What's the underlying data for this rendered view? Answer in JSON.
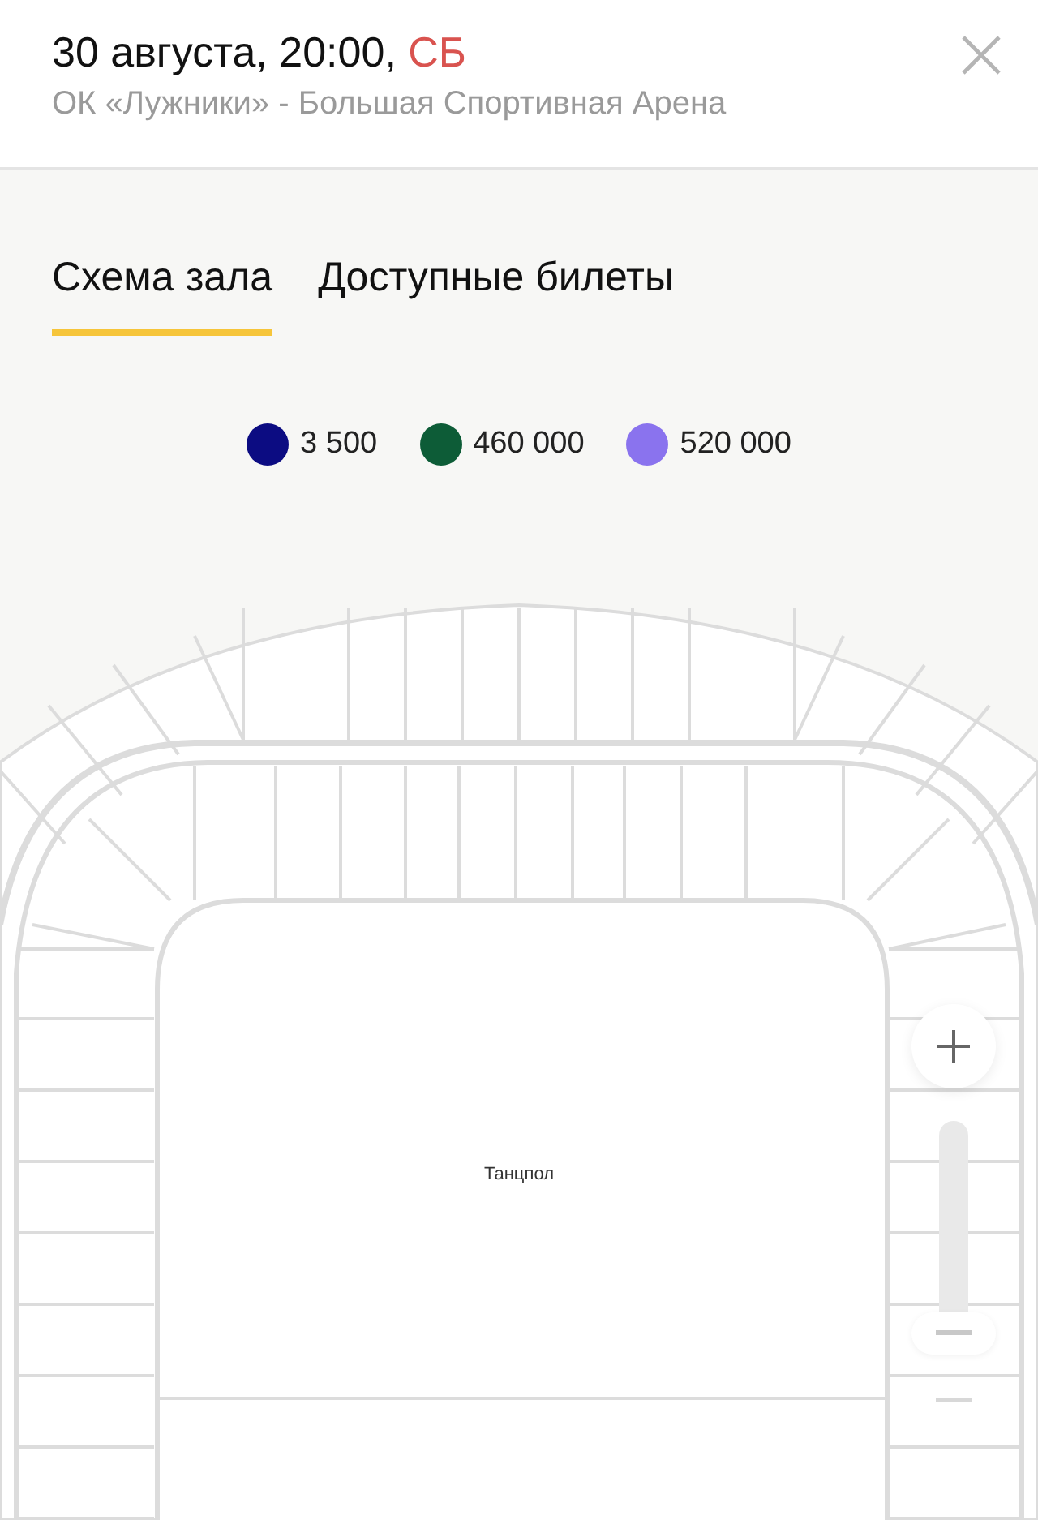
{
  "header": {
    "date": "30 августа, 20:00,",
    "weekday": "СБ",
    "venue": "ОК «Лужники» - Большая Спортивная Арена"
  },
  "tabs": [
    {
      "label": "Схема зала",
      "selected": true
    },
    {
      "label": "Доступные билеты",
      "selected": false
    }
  ],
  "legend": [
    {
      "price": "3 500",
      "color": "#0c0c82"
    },
    {
      "price": "460 000",
      "color": "#0d5c37"
    },
    {
      "price": "520 000",
      "color": "#8a73ee"
    }
  ],
  "map": {
    "floor_label": "Танцпол"
  },
  "zoom": {
    "level": 0,
    "zoom_out_disabled": true
  }
}
